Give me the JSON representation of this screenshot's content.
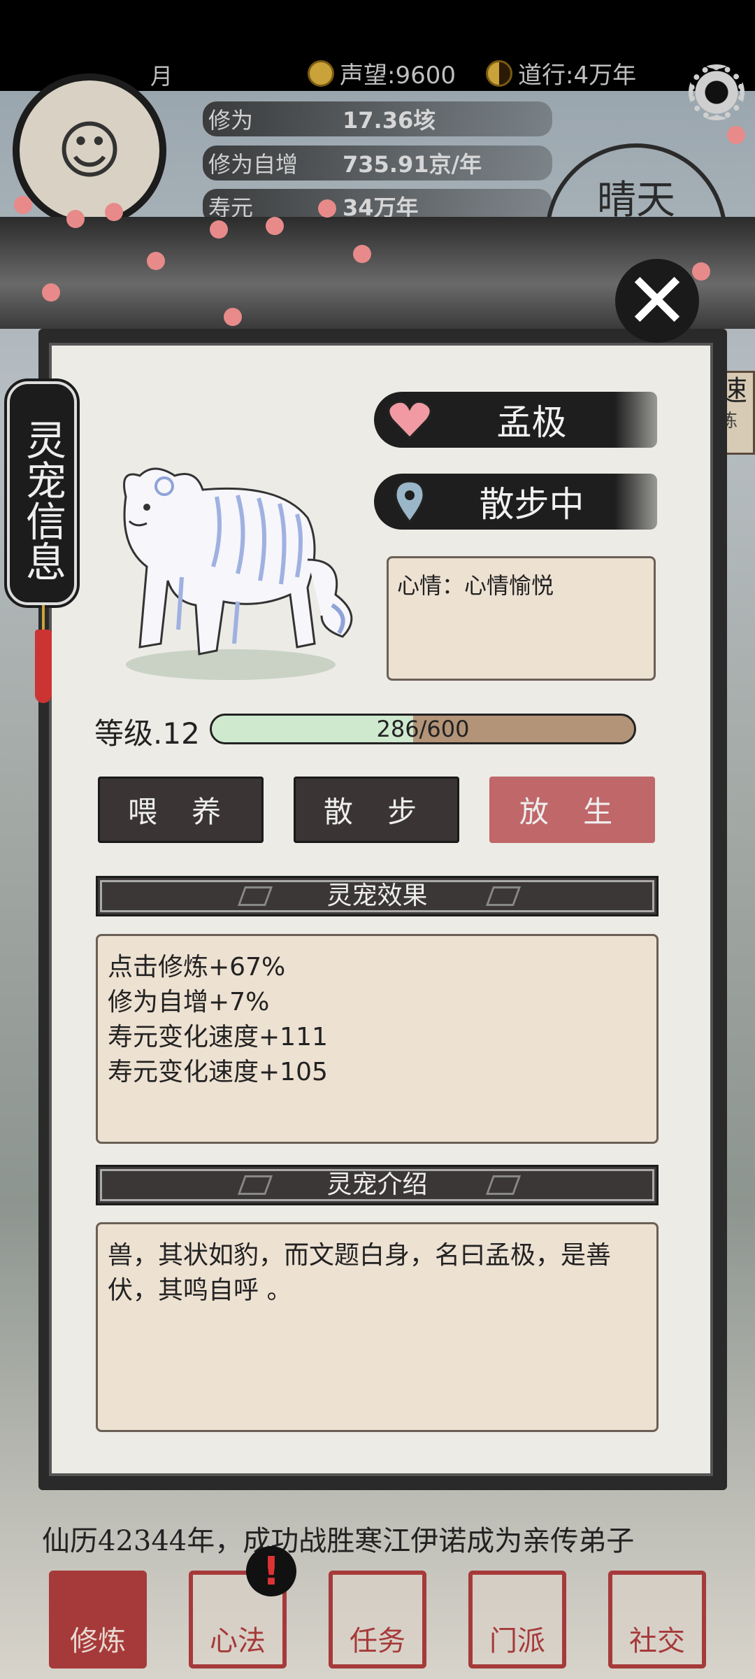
{
  "topbar": {
    "month": "月",
    "reputation": "声望:9600",
    "daoxing": "道行:4万年"
  },
  "player_stats": [
    {
      "label": "修为",
      "value": "17.36垓"
    },
    {
      "label": "修为自增",
      "value": "735.91京/年"
    },
    {
      "label": "寿元",
      "value": "34万年"
    }
  ],
  "weather": "晴天",
  "right_tab": {
    "main": "速",
    "sub": "炼"
  },
  "dialog": {
    "side_title": "灵宠信息",
    "pet_name": "孟极",
    "pet_status": "散步中",
    "mood": "心情：心情愉悦",
    "level_label": "等级.12",
    "xp_text": "286/600",
    "xp_fraction": 0.477,
    "actions": [
      "喂 养",
      "散 步",
      "放 生"
    ],
    "effects_title": "灵宠效果",
    "effects": [
      "点击修炼+67%",
      "修为自增+7%",
      "寿元变化速度+111",
      "寿元变化速度+105"
    ],
    "intro_title": "灵宠介绍",
    "intro_text": "兽，其状如豹，而文题白身，名曰孟极，是善伏，其鸣自呼 。"
  },
  "log_lines": [
    "仙历42344年，成功战胜寒江伊诺成为亲传弟子"
  ],
  "bottom_nav": [
    "修炼",
    "心法",
    "任务",
    "门派",
    "社交"
  ],
  "alert_icon": "!",
  "colors": {
    "accent_red": "#c0676a",
    "seal_red": "#a63a3a",
    "xp_green": "#cfe9cf",
    "xp_track": "#b39478"
  }
}
